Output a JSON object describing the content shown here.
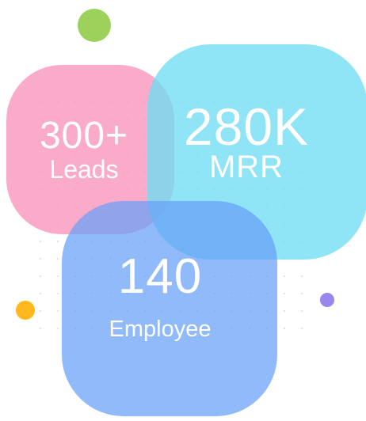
{
  "stats": [
    {
      "value": "300+",
      "label": "Leads"
    },
    {
      "value": "280K",
      "label": "MRR"
    },
    {
      "value": "140",
      "label": "Employee"
    }
  ],
  "colors": {
    "leads_card": "#F794BA",
    "mrr_card": "#70DCF2",
    "employee_card": "#66A0F8",
    "dot_green": "#9CD25B",
    "dot_yellow": "#FFB81E",
    "dot_purple": "#9A87EE"
  },
  "decorations": [
    "green-dot",
    "yellow-dot",
    "purple-dot",
    "dotted-grid"
  ]
}
